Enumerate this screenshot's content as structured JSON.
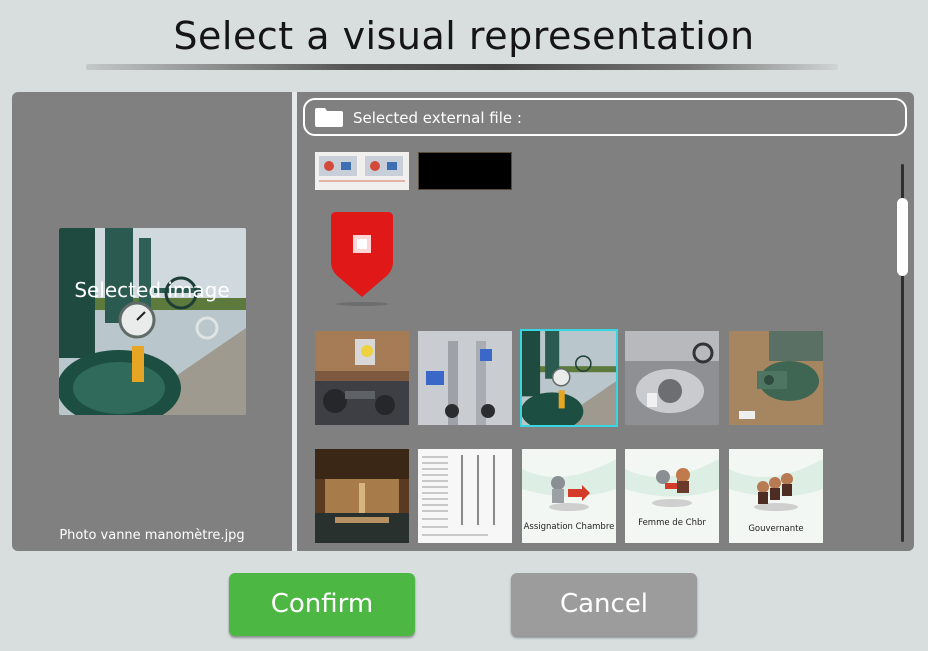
{
  "dialog": {
    "title": "Select a visual representation"
  },
  "selected": {
    "label": "Selected image",
    "filename": "Photo vanne manomètre.jpg"
  },
  "browser": {
    "external_file_label": "Selected external file :",
    "thumbnails": [
      {
        "name": "thumb-diagram-strip",
        "kind": "diagram"
      },
      {
        "name": "thumb-black",
        "kind": "black"
      },
      {
        "name": "thumb-red-pin",
        "kind": "red-pin"
      },
      {
        "name": "thumb-pump-room",
        "kind": "photo"
      },
      {
        "name": "thumb-chrome-valves",
        "kind": "photo"
      },
      {
        "name": "thumb-valve-manometer",
        "kind": "photo",
        "selected": true
      },
      {
        "name": "thumb-grey-valve",
        "kind": "photo"
      },
      {
        "name": "thumb-green-valve",
        "kind": "photo"
      },
      {
        "name": "thumb-pool",
        "kind": "photo"
      },
      {
        "name": "thumb-document",
        "kind": "document"
      },
      {
        "name": "thumb-assignation-chambre",
        "kind": "card",
        "caption": "Assignation Chambre"
      },
      {
        "name": "thumb-femme-de-chbr",
        "kind": "card",
        "caption": "Femme de Chbr"
      },
      {
        "name": "thumb-gouvernante",
        "kind": "card",
        "caption": "Gouvernante"
      }
    ]
  },
  "buttons": {
    "confirm": "Confirm",
    "cancel": "Cancel"
  },
  "colors": {
    "background": "#d7dedd",
    "panel": "#808080",
    "confirm": "#4db744",
    "cancel": "#9c9c9c",
    "selection": "#38d6de"
  }
}
